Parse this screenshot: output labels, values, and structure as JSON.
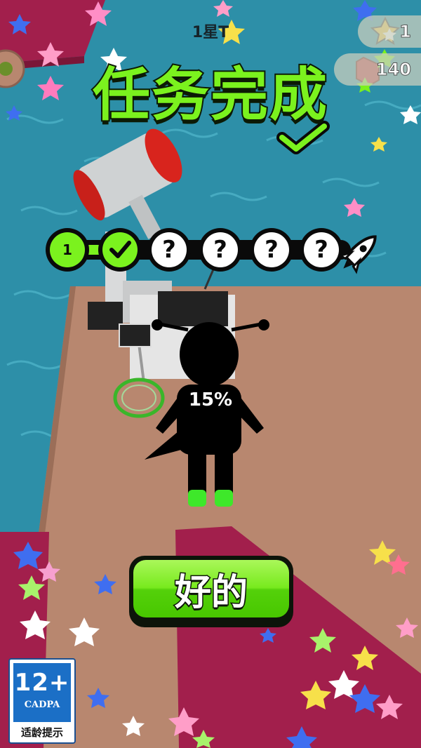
{
  "hud": {
    "level_label": "1星T",
    "stars_count": "1",
    "gems_count": "140"
  },
  "banner": {
    "title": "任务完成",
    "check_icon": "checkmark-icon"
  },
  "progress_track": {
    "nodes": [
      {
        "state": "done",
        "label": "1"
      },
      {
        "state": "done-check",
        "label": ""
      },
      {
        "state": "locked",
        "label": "?"
      },
      {
        "state": "locked",
        "label": "?"
      },
      {
        "state": "locked",
        "label": "?"
      },
      {
        "state": "locked",
        "label": "?"
      }
    ],
    "end_icon": "rocket-icon"
  },
  "character": {
    "progress_percent": "15%"
  },
  "ok_button": {
    "label": "好的"
  },
  "age_badge": {
    "age": "12+",
    "org": "CADPA",
    "note": "适龄提示"
  },
  "colors": {
    "accent_green": "#78ea1e",
    "water": "#2d8fa8",
    "floor": "#b8876f",
    "carpet": "#a21f4c"
  }
}
